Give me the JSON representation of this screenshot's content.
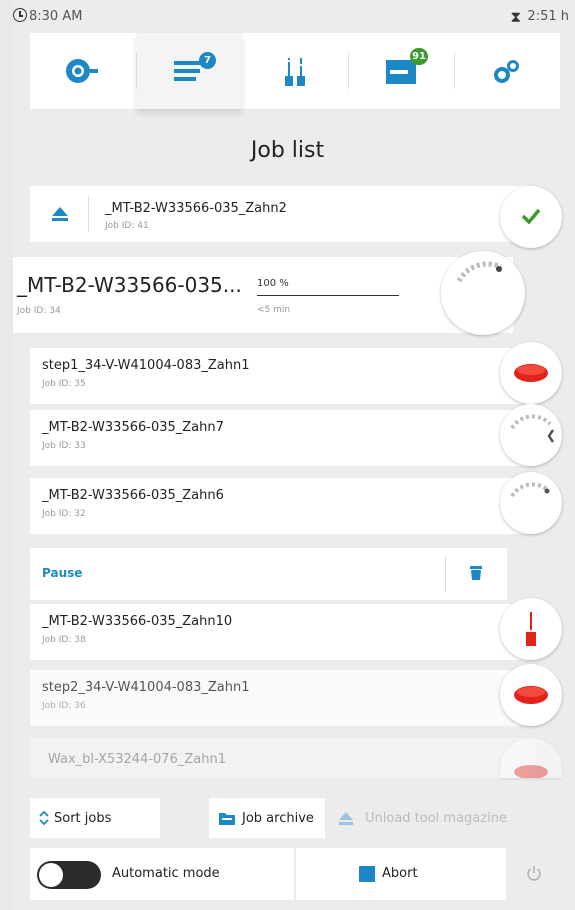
{
  "status": {
    "time": "8:30 AM",
    "remaining": "2:51 h"
  },
  "nav": {
    "tabs": [
      {
        "name": "machine",
        "badge": ""
      },
      {
        "name": "job-list",
        "badge": "7"
      },
      {
        "name": "tools",
        "badge": ""
      },
      {
        "name": "material",
        "badge": "91"
      },
      {
        "name": "settings",
        "badge": ""
      }
    ]
  },
  "title": "Job list",
  "jobs": {
    "done": {
      "name": "_MT-B2-W33566-035_Zahn2",
      "id": "Job ID: 41"
    },
    "active": {
      "name": "_MT-B2-W33566-035...",
      "id": "Job ID: 34",
      "progress": "100 %",
      "eta": "<5 min",
      "progress_value": 1.0
    },
    "list": [
      {
        "name": "step1_34-V-W41004-083_Zahn1",
        "id": "Job ID: 35"
      },
      {
        "name": "_MT-B2-W33566-035_Zahn7",
        "id": "Job ID: 33"
      },
      {
        "name": "_MT-B2-W33566-035_Zahn6",
        "id": "Job ID: 32"
      }
    ],
    "pause_label": "Pause",
    "after_pause": [
      {
        "name": "_MT-B2-W33566-035_Zahn10",
        "id": "Job ID: 38"
      },
      {
        "name": "step2_34-V-W41004-083_Zahn1",
        "id": "Job ID: 36"
      },
      {
        "name": "Wax_bl-X53244-076_Zahn1",
        "id": ""
      }
    ]
  },
  "actions": {
    "sort": "Sort jobs",
    "archive": "Job archive",
    "unload": "Unload tool magazine"
  },
  "bottom": {
    "auto_mode": "Automatic mode",
    "abort": "Abort"
  },
  "colors": {
    "accent": "#1e88c7",
    "check": "#3a9a2c",
    "red": "#e0241b"
  }
}
